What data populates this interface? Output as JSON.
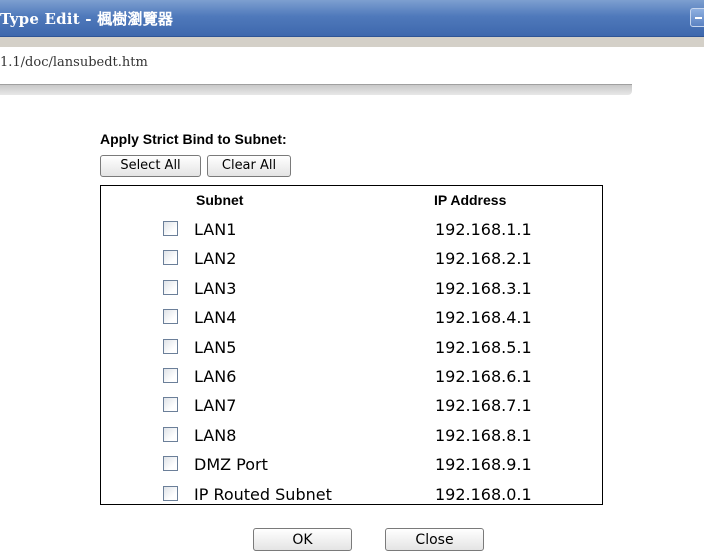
{
  "window": {
    "title": "Type Edit - 楓樹瀏覽器"
  },
  "address": {
    "url": "1.1/doc/lansubedt.htm"
  },
  "form": {
    "heading": "Apply Strict Bind to Subnet:",
    "select_all_label": "Select All",
    "clear_all_label": "Clear All",
    "columns": {
      "subnet": "Subnet",
      "ip": "IP Address"
    },
    "rows": [
      {
        "subnet": "LAN1",
        "ip": "192.168.1.1",
        "checked": false
      },
      {
        "subnet": "LAN2",
        "ip": "192.168.2.1",
        "checked": false
      },
      {
        "subnet": "LAN3",
        "ip": "192.168.3.1",
        "checked": false
      },
      {
        "subnet": "LAN4",
        "ip": "192.168.4.1",
        "checked": false
      },
      {
        "subnet": "LAN5",
        "ip": "192.168.5.1",
        "checked": false
      },
      {
        "subnet": "LAN6",
        "ip": "192.168.6.1",
        "checked": false
      },
      {
        "subnet": "LAN7",
        "ip": "192.168.7.1",
        "checked": false
      },
      {
        "subnet": "LAN8",
        "ip": "192.168.8.1",
        "checked": false
      },
      {
        "subnet": "DMZ Port",
        "ip": "192.168.9.1",
        "checked": false
      },
      {
        "subnet": "IP Routed Subnet",
        "ip": "192.168.0.1",
        "checked": false
      }
    ],
    "ok_label": "OK",
    "close_label": "Close"
  },
  "colors": {
    "titlebar": "#4f79bb",
    "title_text": "#ffffff"
  }
}
